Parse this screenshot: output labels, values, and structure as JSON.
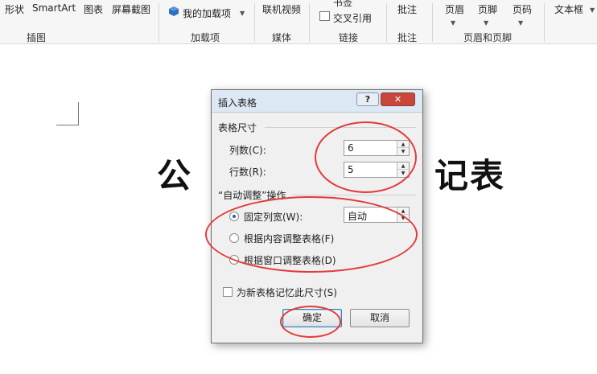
{
  "ribbon": {
    "items": {
      "shapes": "形状",
      "smartart": "SmartArt",
      "chart": "图表",
      "screenshot": "屏幕截图",
      "addins": "我的加载项",
      "online_video": "联机视频",
      "bookmark": "书签",
      "cross_reference": "交叉引用",
      "comment": "批注",
      "header": "页眉",
      "footer": "页脚",
      "page_number": "页码",
      "textbox": "文本框"
    },
    "groups": {
      "illustrations": "插图",
      "addins": "加载项",
      "media": "媒体",
      "links": "链接",
      "comments": "批注",
      "header_footer": "页眉和页脚"
    },
    "colors": {
      "addin_icon": "#2e6fbd"
    }
  },
  "document": {
    "title_left": "公",
    "title_right": "记表"
  },
  "dialog": {
    "title": "插入表格",
    "help": "?",
    "close": "✕",
    "size_section": "表格尺寸",
    "columns_label": "列数(C):",
    "columns_value": "6",
    "rows_label": "行数(R):",
    "rows_value": "5",
    "autofit_section": "“自动调整”操作",
    "fixed_width_label": "固定列宽(W):",
    "fixed_width_value": "自动",
    "fixed_width_checked": true,
    "autofit_contents_label": "根据内容调整表格(F)",
    "autofit_window_label": "根据窗口调整表格(D)",
    "remember_label": "为新表格记忆此尺寸(S)",
    "remember_checked": false,
    "ok": "确定",
    "cancel": "取消"
  },
  "annotation": {
    "color": "#e33a3a"
  }
}
